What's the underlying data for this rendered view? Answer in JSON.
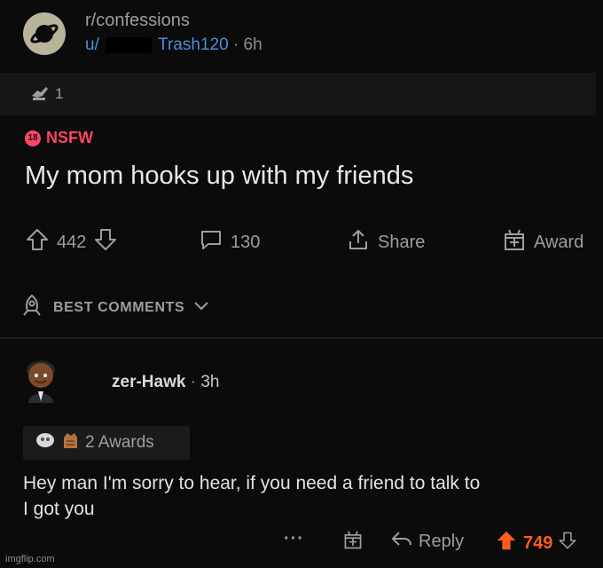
{
  "post": {
    "subreddit": "r/confessions",
    "user_prefix": "u/",
    "username": "Trash120",
    "separator": "·",
    "time": "6h",
    "awards_count": "1",
    "nsfw_label": "NSFW",
    "nsfw_badge": "18",
    "title": "My mom hooks up with my friends"
  },
  "actions": {
    "upvotes": "442",
    "comments": "130",
    "share_label": "Share",
    "award_label": "Award"
  },
  "sort": {
    "label": "BEST COMMENTS"
  },
  "comment": {
    "author": "zer-Hawk",
    "separator": "·",
    "time": "3h",
    "awards_label": "2 Awards",
    "body_line1": "Hey man I'm sorry to hear, if you need a friend to talk to",
    "body_line2": "I got you",
    "more_label": "···",
    "reply_label": "Reply",
    "score": "749"
  },
  "watermark": "imgflip.com",
  "colors": {
    "background": "#0b0b0b",
    "nsfw": "#ff4565",
    "username_link": "#4a8fd8",
    "upvote_active": "#ff5b1f",
    "muted_text": "#9a9ea1"
  },
  "icons": [
    "subreddit-planet-icon",
    "award-hand-icon",
    "upvote-icon",
    "downvote-icon",
    "comment-bubble-icon",
    "share-icon",
    "award-gift-icon",
    "rocket-sort-icon",
    "chevron-down-icon",
    "avatar",
    "award-silver-icon",
    "award-hand2-icon",
    "more-icon",
    "reply-arrow-icon",
    "upvote-filled-icon"
  ]
}
